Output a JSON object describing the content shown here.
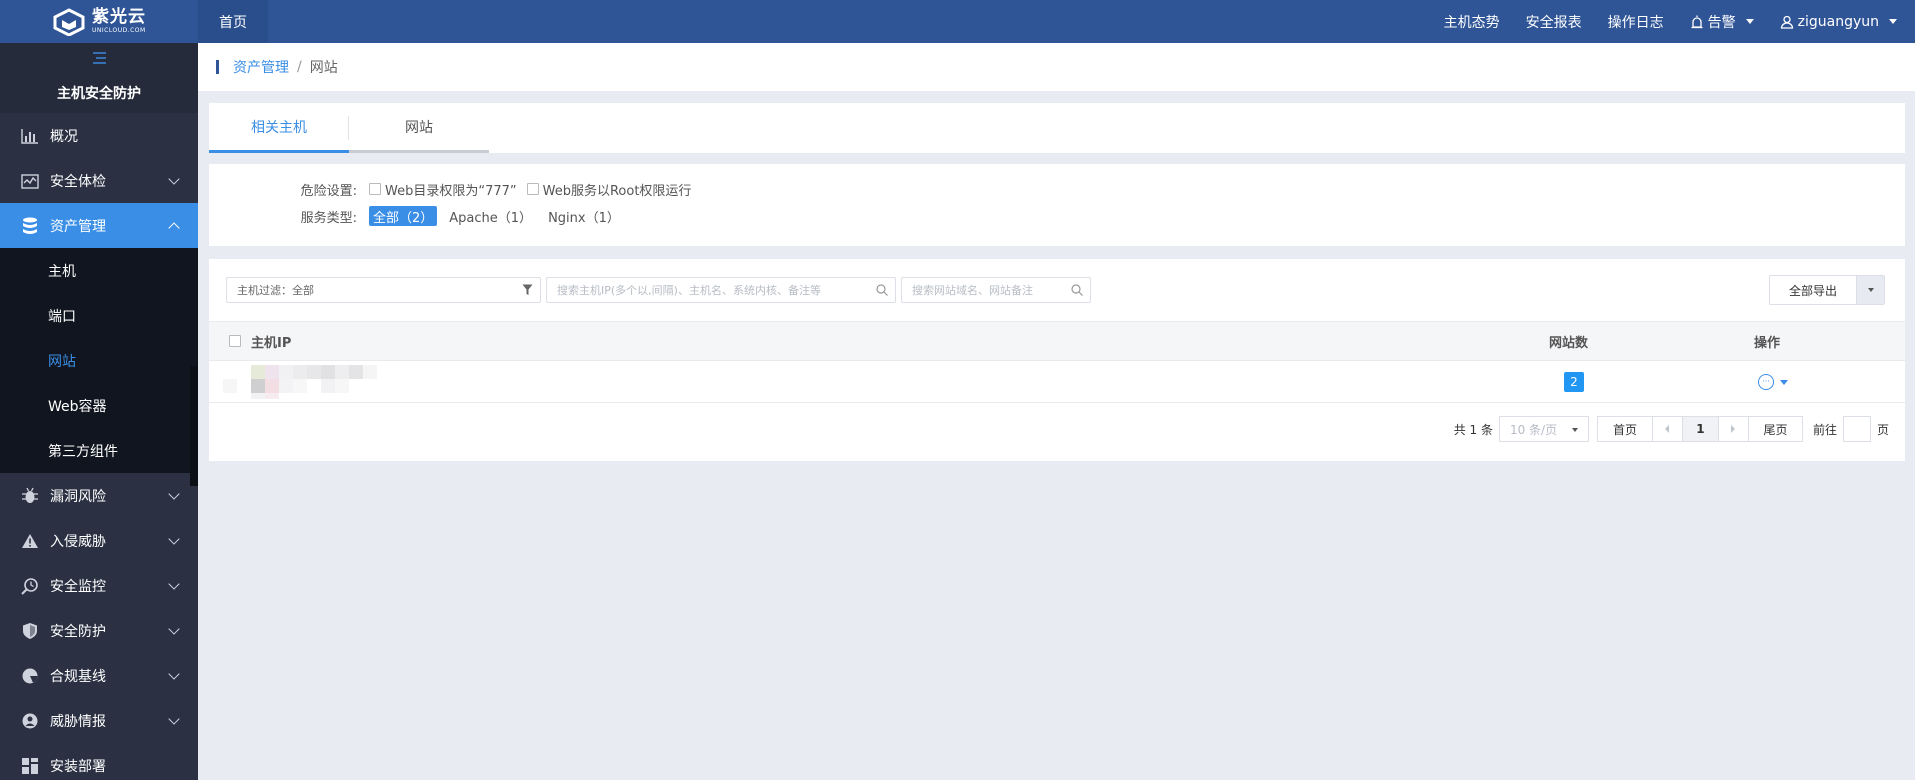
{
  "topbar": {
    "logo_cn": "紫光云",
    "logo_en": "UNICLOUD.COM",
    "home": "首页",
    "nav": [
      "主机态势",
      "安全报表",
      "操作日志"
    ],
    "alert_label": "告警",
    "user": "ziguangyun"
  },
  "sidebar": {
    "title": "主机安全防护",
    "groups": [
      {
        "label": "概况",
        "icon": "chart-icon"
      },
      {
        "label": "安全体检",
        "icon": "checkup-icon"
      },
      {
        "label": "资产管理",
        "icon": "database-icon"
      },
      {
        "label": "漏洞风险",
        "icon": "bug-icon"
      },
      {
        "label": "入侵威胁",
        "icon": "warning-icon"
      },
      {
        "label": "安全监控",
        "icon": "monitor-icon"
      },
      {
        "label": "安全防护",
        "icon": "shield-icon"
      },
      {
        "label": "合规基线",
        "icon": "baseline-icon"
      },
      {
        "label": "威胁情报",
        "icon": "intel-icon"
      },
      {
        "label": "安装部署",
        "icon": "deploy-icon"
      }
    ],
    "asset_sub": [
      "主机",
      "端口",
      "网站",
      "Web容器",
      "第三方组件"
    ]
  },
  "breadcrumb": {
    "parent": "资产管理",
    "sep": "/",
    "current": "网站"
  },
  "tabs": [
    "相关主机",
    "网站"
  ],
  "filters": {
    "danger_label": "危险设置:",
    "danger_opts": [
      "Web目录权限为“777”",
      "Web服务以Root权限运行"
    ],
    "service_label": "服务类型:",
    "service_opts": [
      "全部（2）",
      "Apache（1）",
      "Nginx（1）"
    ]
  },
  "toolbar": {
    "host_filter": "主机过滤：全部",
    "search_host_ph": "搜索主机IP(多个以,间隔)、主机名、系统内核、备注等",
    "search_site_ph": "搜索网站域名、网站备注",
    "export": "全部导出"
  },
  "table": {
    "col_ip": "主机IP",
    "col_sites": "网站数",
    "col_ops": "操作",
    "rows": [
      {
        "sites": "2"
      }
    ]
  },
  "pager": {
    "total": "共 1 条",
    "page_size": "10 条/页",
    "first": "首页",
    "current": "1",
    "last": "尾页",
    "goto": "前往",
    "page": "页"
  }
}
